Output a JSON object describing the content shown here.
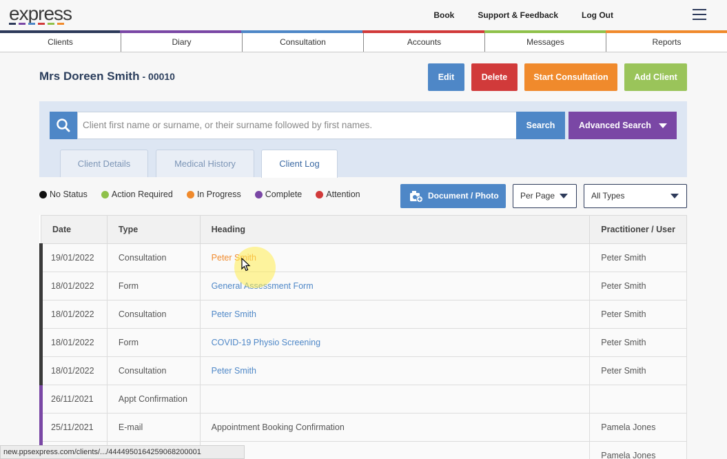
{
  "app": {
    "logo_text": "express",
    "logo_stripe_colors": [
      "#2d3a5a",
      "#7a47a5",
      "#4e87c7",
      "#d13a3a",
      "#8fc14a",
      "#f08a2c"
    ]
  },
  "topnav": {
    "book": "Book",
    "support": "Support & Feedback",
    "logout": "Log Out",
    "menu_icon": "hamburger-icon"
  },
  "nav_colors": [
    "#2d3a5a",
    "#7a47a5",
    "#4e87c7",
    "#d13a3a",
    "#8fc14a",
    "#f08a2c"
  ],
  "nav": [
    "Clients",
    "Diary",
    "Consultation",
    "Accounts",
    "Messages",
    "Reports"
  ],
  "client": {
    "name": "Mrs Doreen Smith",
    "number": "- 00010"
  },
  "actions": {
    "edit": {
      "label": "Edit",
      "color": "#4e87c7"
    },
    "delete": {
      "label": "Delete",
      "color": "#d13a3a"
    },
    "start": {
      "label": "Start Consultation",
      "color": "#f08a2c"
    },
    "add": {
      "label": "Add Client",
      "color": "#9ac45a"
    }
  },
  "search": {
    "placeholder": "Client first name or surname, or their surname followed by first names.",
    "button": "Search",
    "advanced": "Advanced Search"
  },
  "tabs": [
    {
      "label": "Client Details",
      "active": false
    },
    {
      "label": "Medical History",
      "active": false
    },
    {
      "label": "Client Log",
      "active": true
    }
  ],
  "legend": [
    {
      "label": "No Status",
      "color": "#111111"
    },
    {
      "label": "Action Required",
      "color": "#8fc14a"
    },
    {
      "label": "In Progress",
      "color": "#f08a2c"
    },
    {
      "label": "Complete",
      "color": "#7a47a5"
    },
    {
      "label": "Attention",
      "color": "#d13a3a"
    }
  ],
  "toolbar": {
    "document_photo": "Document / Photo",
    "per_page": "Per Page",
    "types": "All Types"
  },
  "table": {
    "headers": [
      "Date",
      "Type",
      "Heading",
      "Practitioner / User"
    ],
    "rows": [
      {
        "date": "19/01/2022",
        "type": "Consultation",
        "heading": "Peter Smith",
        "user": "Peter Smith",
        "link": true,
        "hover": true,
        "status": "none"
      },
      {
        "date": "18/01/2022",
        "type": "Form",
        "heading": "General Assessment Form",
        "user": "Peter Smith",
        "link": true,
        "hover": false,
        "status": "none"
      },
      {
        "date": "18/01/2022",
        "type": "Consultation",
        "heading": "Peter Smith",
        "user": "Peter Smith",
        "link": true,
        "hover": false,
        "status": "none"
      },
      {
        "date": "18/01/2022",
        "type": "Form",
        "heading": "COVID-19 Physio Screening",
        "user": "Peter Smith",
        "link": true,
        "hover": false,
        "status": "none"
      },
      {
        "date": "18/01/2022",
        "type": "Consultation",
        "heading": "Peter Smith",
        "user": "Peter Smith",
        "link": true,
        "hover": false,
        "status": "none"
      },
      {
        "date": "26/11/2021",
        "type": "Appt Confirmation",
        "heading": "",
        "user": "",
        "link": false,
        "hover": false,
        "status": "complete"
      },
      {
        "date": "25/11/2021",
        "type": "E-mail",
        "heading": "Appointment Booking Confirmation",
        "user": "Pamela Jones",
        "link": false,
        "hover": false,
        "status": "complete"
      },
      {
        "date": "",
        "type": "",
        "heading": "",
        "user": "Pamela Jones",
        "link": false,
        "hover": false,
        "status": "complete"
      }
    ]
  },
  "statusbar": "new.ppsexpress.com/clients/.../4444950164259068200001"
}
